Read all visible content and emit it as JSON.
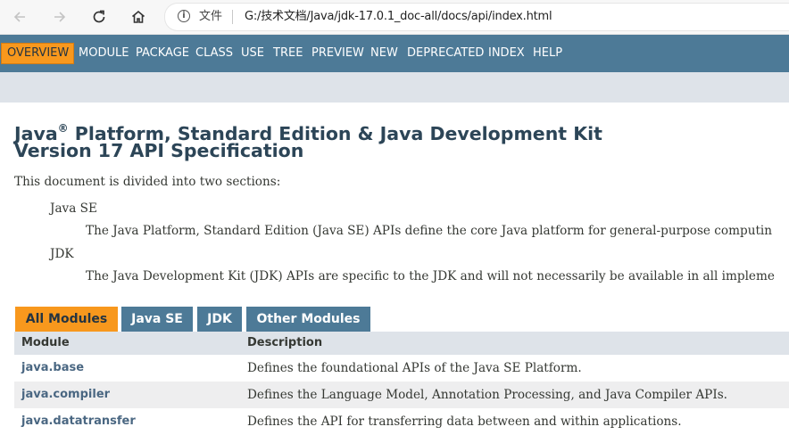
{
  "browser": {
    "scheme_label": "文件",
    "url": "G:/技术文档/Java/jdk-17.0.1_doc-all/docs/api/index.html"
  },
  "nav": {
    "items": [
      "OVERVIEW",
      "MODULE",
      "PACKAGE",
      "CLASS",
      "USE",
      "TREE",
      "PREVIEW",
      "NEW",
      "DEPRECATED",
      "INDEX",
      "HELP"
    ]
  },
  "header": {
    "title_java": "Java",
    "title_reg": "®",
    "title_rest": " Platform, Standard Edition & Java Development Kit",
    "title_line2": "Version 17 API Specification"
  },
  "intro": "This document is divided into two sections:",
  "sections": [
    {
      "term": "Java SE",
      "desc": "The Java Platform, Standard Edition (Java SE) APIs define the core Java platform for general-purpose computin"
    },
    {
      "term": "JDK",
      "desc": "The Java Development Kit (JDK) APIs are specific to the JDK and will not necessarily be available in all impleme"
    }
  ],
  "tabs": [
    "All Modules",
    "Java SE",
    "JDK",
    "Other Modules"
  ],
  "table": {
    "headers": [
      "Module",
      "Description"
    ],
    "rows": [
      {
        "module": "java.base",
        "description": "Defines the foundational APIs of the Java SE Platform."
      },
      {
        "module": "java.compiler",
        "description": "Defines the Language Model, Annotation Processing, and Java Compiler APIs."
      },
      {
        "module": "java.datatransfer",
        "description": "Defines the API for transferring data between and within applications."
      }
    ]
  },
  "colors": {
    "nav_bg": "#4d7a97",
    "active_orange": "#f8981d",
    "subnav_bg": "#dee3e9",
    "link": "#4a6782"
  }
}
